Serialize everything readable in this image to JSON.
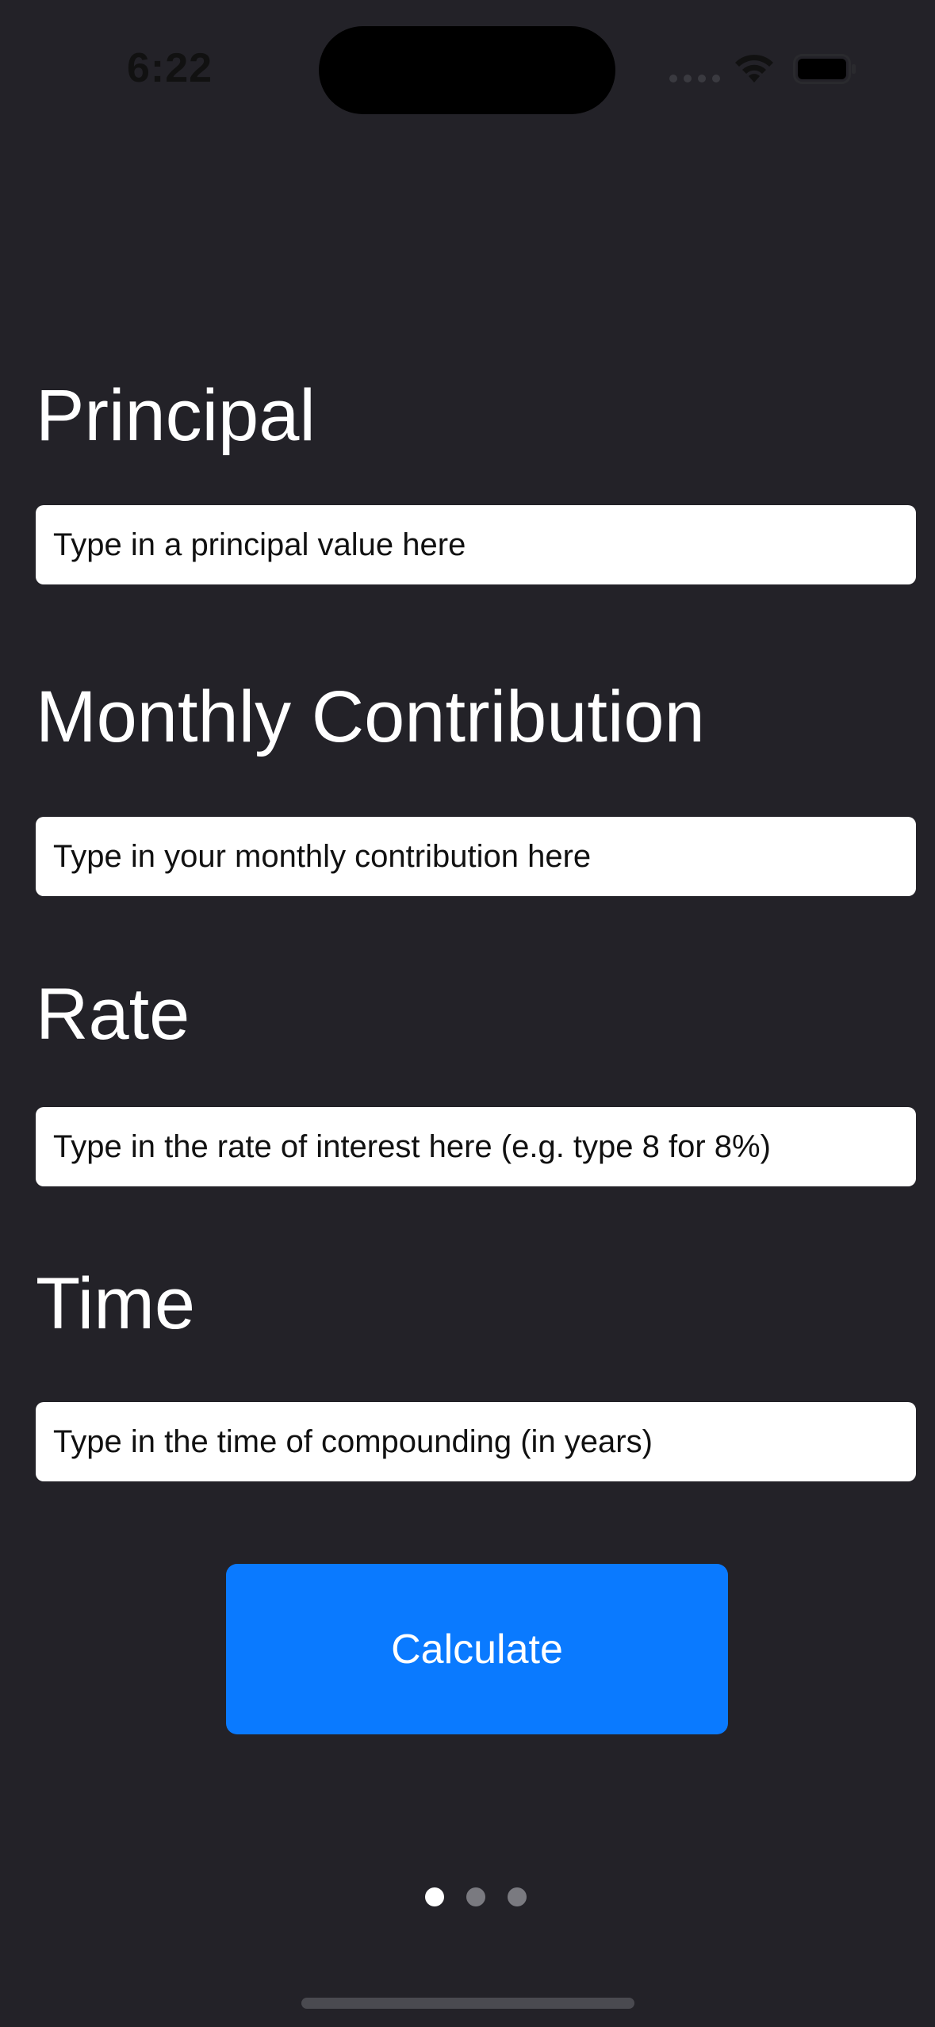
{
  "status_bar": {
    "time": "6:22",
    "icons": [
      "signal-dots-icon",
      "wifi-icon",
      "battery-icon"
    ]
  },
  "form": {
    "principal": {
      "label": "Principal",
      "value": "",
      "placeholder": "Type in a principal value here"
    },
    "monthly_contribution": {
      "label": "Monthly Contribution",
      "value": "",
      "placeholder": "Type in your monthly contribution here"
    },
    "rate": {
      "label": "Rate",
      "value": "",
      "placeholder": "Type in the rate of interest here (e.g. type 8 for 8%)"
    },
    "time": {
      "label": "Time",
      "value": "",
      "placeholder": "Type in the time of compounding (in years)"
    }
  },
  "calculate_button": {
    "label": "Calculate"
  },
  "pager": {
    "page_count": 3,
    "current_page": 1
  },
  "colors": {
    "background": "#232228",
    "accent": "#0a7aff",
    "input_background": "#ffffff"
  }
}
